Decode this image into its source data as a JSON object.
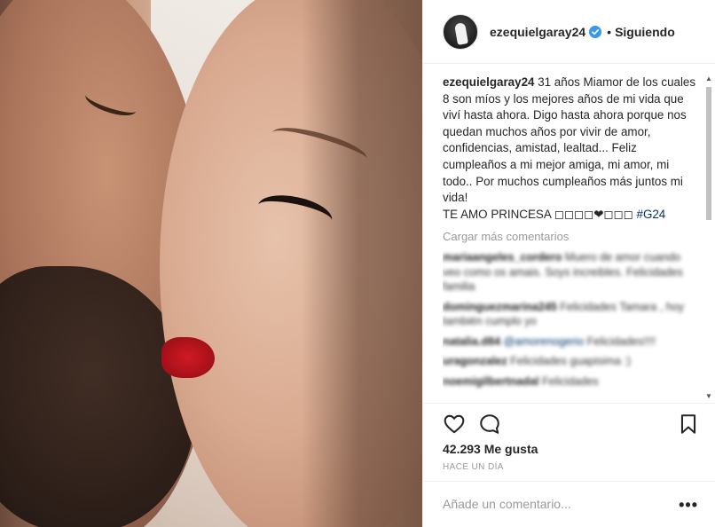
{
  "post": {
    "username": "ezequielgaray24",
    "follow_label": "Siguiendo",
    "dot": "•",
    "caption_user": "ezequielgaray24",
    "caption_text": " 31 años Miamor de los cuales 8 son míos y los mejores años de mi vida que viví hasta ahora. Digo hasta ahora porque nos quedan muchos años por vivir de amor, confidencias, amistad, lealtad... Feliz cumpleaños a mi mejor amiga, mi amor, mi todo.. Por muchos cumpleaños más juntos mi vida!",
    "caption_line2": "TE AMO PRINCESA ◻◻◻◻❤◻◻◻ ",
    "caption_hashtag": "#G24",
    "load_more": "Cargar más comentarios",
    "likes": "42.293 Me gusta",
    "time": "HACE UN DÍA",
    "comment_placeholder": "Añade un comentario...",
    "more_label": "•••"
  },
  "comments": [
    {
      "user": "mariaangeles_cordero",
      "text": " Muero de amor cuando veo como os amais. Soys increibles. Felicidades familia"
    },
    {
      "user": "dominguezmarina245",
      "text": " Felicidades Tamara , hoy también cumplo yo"
    },
    {
      "user": "natalia.d84",
      "text": " ",
      "mention": "@amorenogerio",
      "after": " Felicidades!!!!"
    },
    {
      "user": "uragonzalez",
      "text": " Felicidades guapisima :)"
    },
    {
      "user": "noemigilbertnadal",
      "text": " Felicidades"
    }
  ],
  "icons": {
    "verified": "verified-badge-icon",
    "like": "heart-icon",
    "comment": "comment-bubble-icon",
    "save": "bookmark-icon"
  },
  "colors": {
    "verified_blue": "#3897f0",
    "hashtag": "#003569",
    "muted": "#999999"
  }
}
